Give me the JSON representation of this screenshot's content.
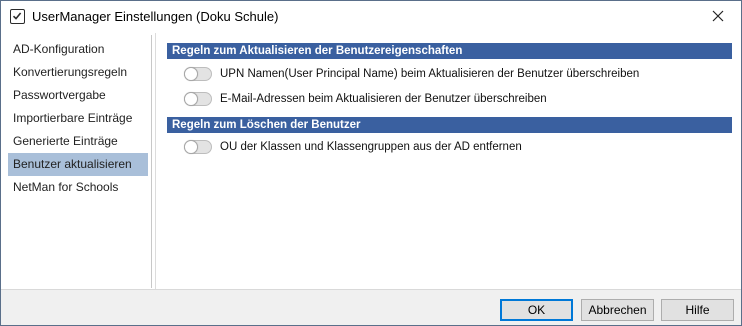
{
  "window": {
    "title": "UserManager Einstellungen (Doku Schule)"
  },
  "sidebar": {
    "items": [
      {
        "label": "AD-Konfiguration",
        "active": false
      },
      {
        "label": "Konvertierungsregeln",
        "active": false
      },
      {
        "label": "Passwortvergabe",
        "active": false
      },
      {
        "label": "Importierbare Einträge",
        "active": false
      },
      {
        "label": "Generierte Einträge",
        "active": false
      },
      {
        "label": "Benutzer aktualisieren",
        "active": true
      },
      {
        "label": "NetMan for Schools",
        "active": false
      }
    ]
  },
  "main": {
    "sections": [
      {
        "title": "Regeln zum Aktualisieren der Benutzereigenschaften",
        "options": [
          {
            "label": "UPN Namen(User Principal Name) beim Aktualisieren der Benutzer überschreiben",
            "enabled": false
          },
          {
            "label": "E-Mail-Adressen beim Aktualisieren der Benutzer überschreiben",
            "enabled": false
          }
        ]
      },
      {
        "title": "Regeln zum Löschen der Benutzer",
        "options": [
          {
            "label": "OU der Klassen und Klassengruppen aus der AD entfernen",
            "enabled": false
          }
        ]
      }
    ]
  },
  "footer": {
    "ok_label": "OK",
    "cancel_label": "Abbrechen",
    "help_label": "Hilfe"
  },
  "colors": {
    "section_header": "#3a60a0",
    "active_nav": "#a9bfd9",
    "ok_border": "#0078d7"
  },
  "icons": {
    "app": "checkbox-icon",
    "close": "close-icon",
    "toggle": "toggle-off"
  }
}
